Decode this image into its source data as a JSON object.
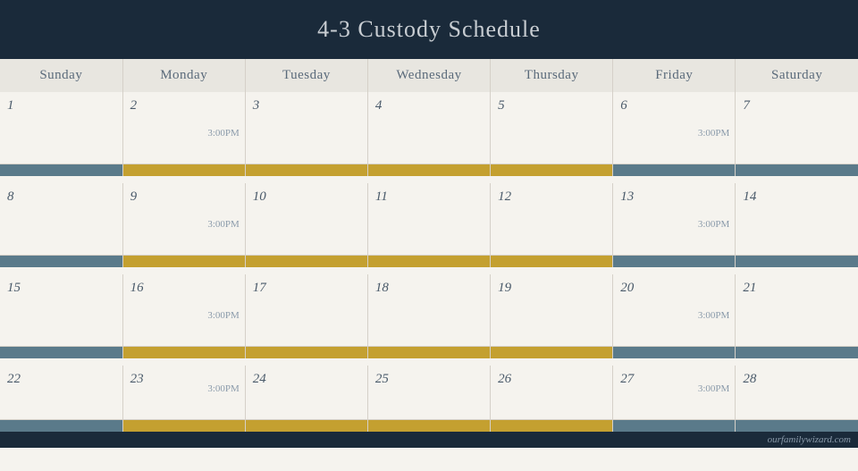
{
  "header": {
    "title": "4-3 Custody Schedule"
  },
  "days": [
    "Sunday",
    "Monday",
    "Tuesday",
    "Wednesday",
    "Thursday",
    "Friday",
    "Saturday"
  ],
  "weeks": [
    {
      "days": [
        1,
        2,
        3,
        4,
        5,
        6,
        7
      ],
      "transition_from": "Monday",
      "transition_to": "Friday",
      "monday_time": "3:00PM",
      "friday_time": "3:00PM",
      "bars": [
        "blue",
        "gold",
        "gold",
        "gold",
        "gold",
        "blue",
        "blue"
      ]
    },
    {
      "days": [
        8,
        9,
        10,
        11,
        12,
        13,
        14
      ],
      "monday_time": "3:00PM",
      "friday_time": "3:00PM",
      "bars": [
        "blue",
        "gold",
        "gold",
        "gold",
        "gold",
        "blue",
        "blue"
      ]
    },
    {
      "days": [
        15,
        16,
        17,
        18,
        19,
        20,
        21
      ],
      "monday_time": "3:00PM",
      "friday_time": "3:00PM",
      "bars": [
        "blue",
        "gold",
        "gold",
        "gold",
        "gold",
        "blue",
        "blue"
      ]
    },
    {
      "days": [
        22,
        23,
        24,
        25,
        26,
        27,
        28
      ],
      "monday_time": "3:00PM",
      "friday_time": "3:00PM",
      "bars": [
        "blue",
        "gold",
        "gold",
        "gold",
        "gold",
        "blue",
        "blue"
      ]
    }
  ],
  "watermark": "ourfamilywizard.com"
}
